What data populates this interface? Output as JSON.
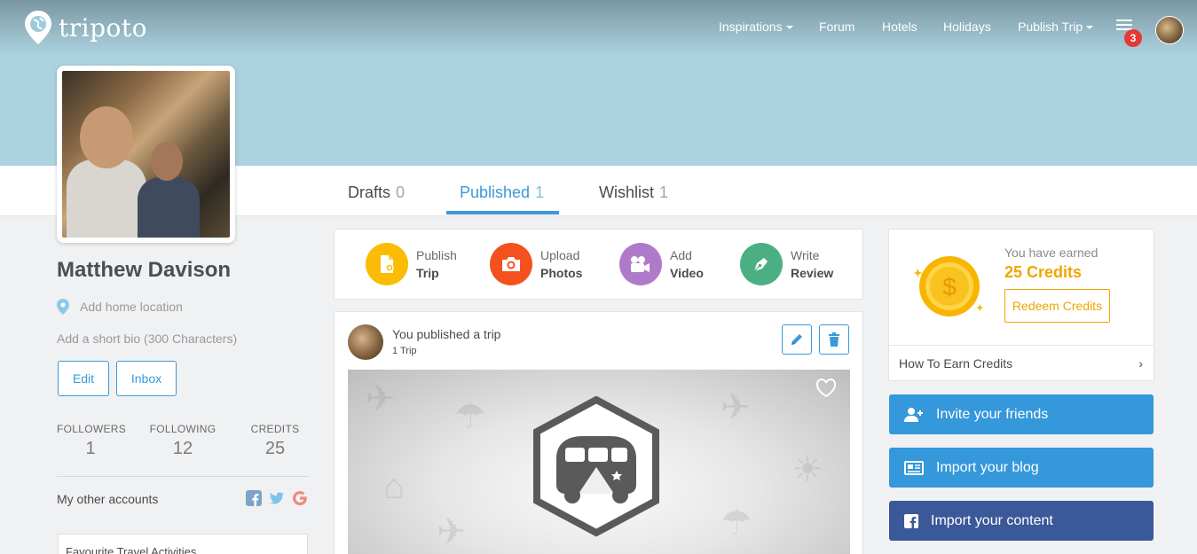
{
  "brand": {
    "name": "tripoto"
  },
  "nav": {
    "items": [
      "Inspirations",
      "Forum",
      "Hotels",
      "Holidays",
      "Publish Trip"
    ],
    "notification_count": "3"
  },
  "tabs": [
    {
      "label": "Drafts",
      "count": "0"
    },
    {
      "label": "Published",
      "count": "1"
    },
    {
      "label": "Wishlist",
      "count": "1"
    }
  ],
  "profile": {
    "name": "Matthew Davison",
    "location_placeholder": "Add home location",
    "bio_placeholder": "Add a short bio (300 Characters)",
    "edit_label": "Edit",
    "inbox_label": "Inbox",
    "stats": [
      {
        "label": "FOLLOWERS",
        "value": "1"
      },
      {
        "label": "FOLLOWING",
        "value": "12"
      },
      {
        "label": "CREDITS",
        "value": "25"
      }
    ],
    "other_accounts_label": "My other accounts",
    "favourite_label": "Favourite Travel Activities"
  },
  "actions": [
    {
      "line1": "Publish",
      "line2": "Trip",
      "icon": "document-icon",
      "color": "#fbbc05"
    },
    {
      "line1": "Upload",
      "line2": "Photos",
      "icon": "camera-icon",
      "color": "#f4511e"
    },
    {
      "line1": "Add",
      "line2": "Video",
      "icon": "video-camera-icon",
      "color": "#b07acb"
    },
    {
      "line1": "Write",
      "line2": "Review",
      "icon": "pen-icon",
      "color": "#4caf84"
    }
  ],
  "feed": {
    "title": "You published a trip",
    "subtitle": "1 Trip"
  },
  "credits_card": {
    "earned_label": "You have earned",
    "credits_text": "25 Credits",
    "redeem_label": "Redeem Credits",
    "how_to_label": "How To Earn Credits"
  },
  "ctas": [
    {
      "label": "Invite your friends",
      "icon": "add-user-icon",
      "color": "#3498db"
    },
    {
      "label": "Import your blog",
      "icon": "newspaper-icon",
      "color": "#3498db"
    },
    {
      "label": "Import your content",
      "icon": "facebook-icon",
      "color": "#3b5998"
    }
  ],
  "colors": {
    "accent": "#3a9ad9",
    "credits": "#f0a500",
    "hero": "#acd2df"
  }
}
